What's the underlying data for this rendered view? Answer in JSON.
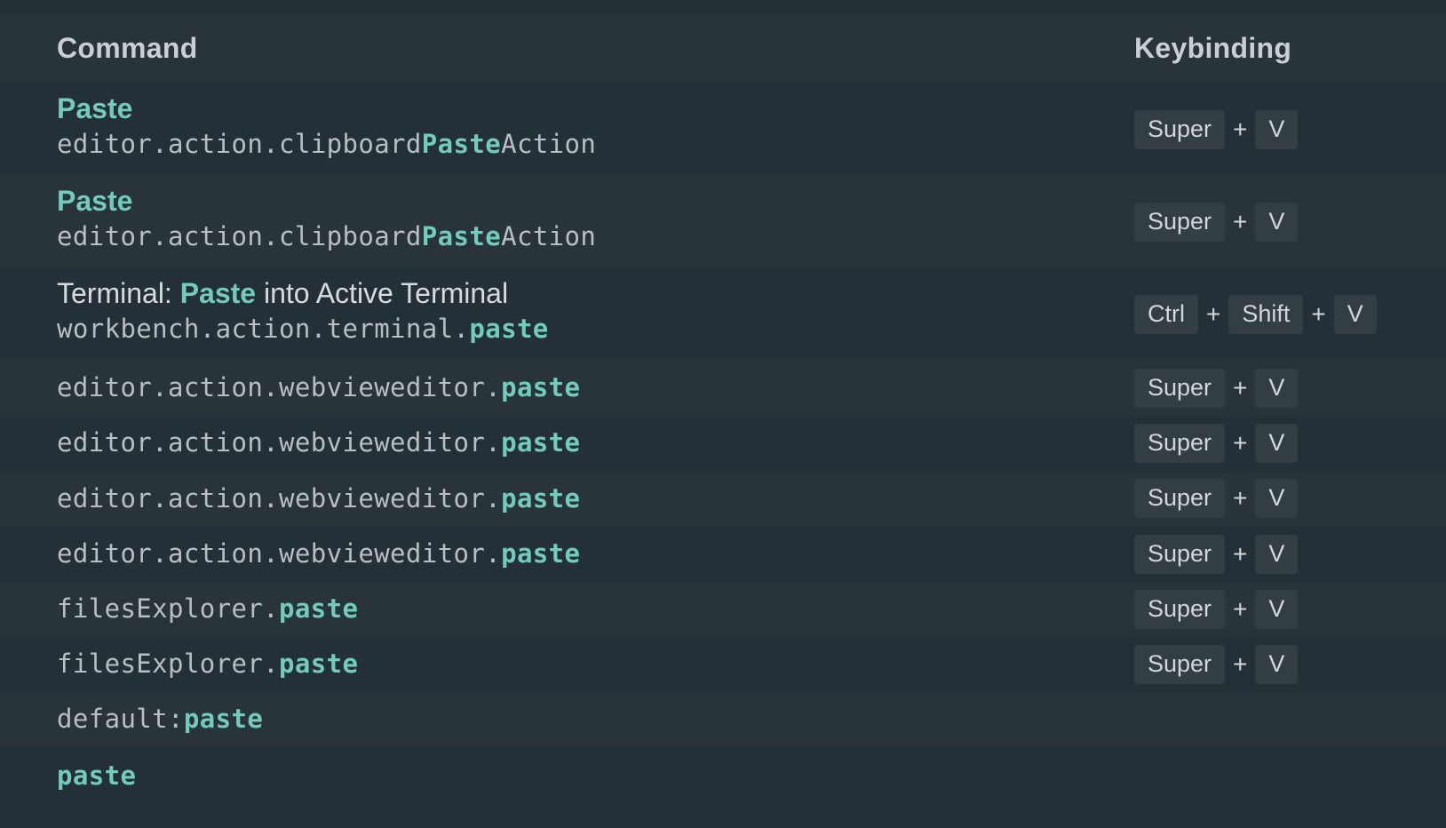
{
  "header": {
    "command": "Command",
    "keybinding": "Keybinding"
  },
  "rows": [
    {
      "title": {
        "pre": "",
        "hl": "Paste",
        "post": ""
      },
      "id": {
        "pre": "editor.action.clipboard",
        "hl": "Paste",
        "post": "Action"
      },
      "keys": [
        "Super",
        "V"
      ]
    },
    {
      "title": {
        "pre": "",
        "hl": "Paste",
        "post": ""
      },
      "id": {
        "pre": "editor.action.clipboard",
        "hl": "Paste",
        "post": "Action"
      },
      "keys": [
        "Super",
        "V"
      ]
    },
    {
      "title": {
        "pre": "Terminal: ",
        "hl": "Paste",
        "post": " into Active Terminal"
      },
      "id": {
        "pre": "workbench.action.terminal.",
        "hl": "paste",
        "post": ""
      },
      "keys": [
        "Ctrl",
        "Shift",
        "V"
      ]
    },
    {
      "id": {
        "pre": "editor.action.webvieweditor.",
        "hl": "paste",
        "post": ""
      },
      "keys": [
        "Super",
        "V"
      ]
    },
    {
      "id": {
        "pre": "editor.action.webvieweditor.",
        "hl": "paste",
        "post": ""
      },
      "keys": [
        "Super",
        "V"
      ]
    },
    {
      "id": {
        "pre": "editor.action.webvieweditor.",
        "hl": "paste",
        "post": ""
      },
      "keys": [
        "Super",
        "V"
      ]
    },
    {
      "id": {
        "pre": "editor.action.webvieweditor.",
        "hl": "paste",
        "post": ""
      },
      "keys": [
        "Super",
        "V"
      ]
    },
    {
      "id": {
        "pre": "filesExplorer.",
        "hl": "paste",
        "post": ""
      },
      "keys": [
        "Super",
        "V"
      ]
    },
    {
      "id": {
        "pre": "filesExplorer.",
        "hl": "paste",
        "post": ""
      },
      "keys": [
        "Super",
        "V"
      ]
    },
    {
      "id": {
        "pre": "default:",
        "hl": "paste",
        "post": ""
      },
      "keys": []
    },
    {
      "id": {
        "pre": "",
        "hl": "paste",
        "post": ""
      },
      "keys": []
    }
  ],
  "plus_sign": "+",
  "colors": {
    "background": "#263037",
    "row_alt": "#28333a",
    "highlight": "#72cbbc",
    "key_bg": "#323d44"
  }
}
